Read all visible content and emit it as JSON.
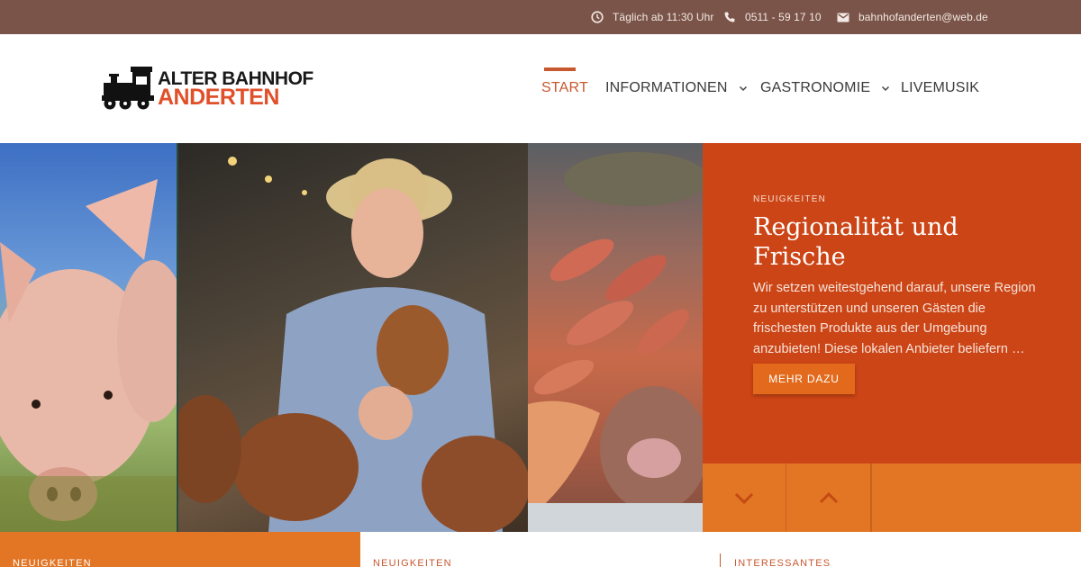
{
  "topbar": {
    "hours": "Täglich ab 11:30 Uhr",
    "phone": "0511 - 59 17 10",
    "email": "bahnhofanderten@web.de",
    "hours_icon": "clock-icon",
    "phone_icon": "phone-icon",
    "email_icon": "mail-icon"
  },
  "logo": {
    "line1": "ALTER BAHNHOF",
    "line2": "ANDERTEN",
    "icon": "locomotive-icon"
  },
  "nav": {
    "items": [
      {
        "label": "START",
        "active": true
      },
      {
        "label": "INFORMATIONEN",
        "has_submenu": true
      },
      {
        "label": "GASTRONOMIE",
        "has_submenu": true
      },
      {
        "label": "LIVEMUSIK"
      }
    ]
  },
  "hero": {
    "kicker": "NEUIGKEITEN",
    "title": "Regionalität und Frische",
    "body": "Wir setzen weitestgehend darauf, unsere Region zu unterstützen und unseren Gästen die frischesten Produkte aus der Umgebung anzubieten! Diese lokalen Anbieter beliefern …",
    "button": "MEHR DAZU",
    "prev_icon": "chevron-down-icon",
    "next_icon": "chevron-up-icon"
  },
  "strip": {
    "col1": "NEUIGKEITEN",
    "col2": "NEUIGKEITEN",
    "col3": "INTERESSANTES"
  },
  "colors": {
    "topbar": "#7a5448",
    "accent": "#c8582f",
    "panel": "#cc4516",
    "orange": "#e27625"
  }
}
